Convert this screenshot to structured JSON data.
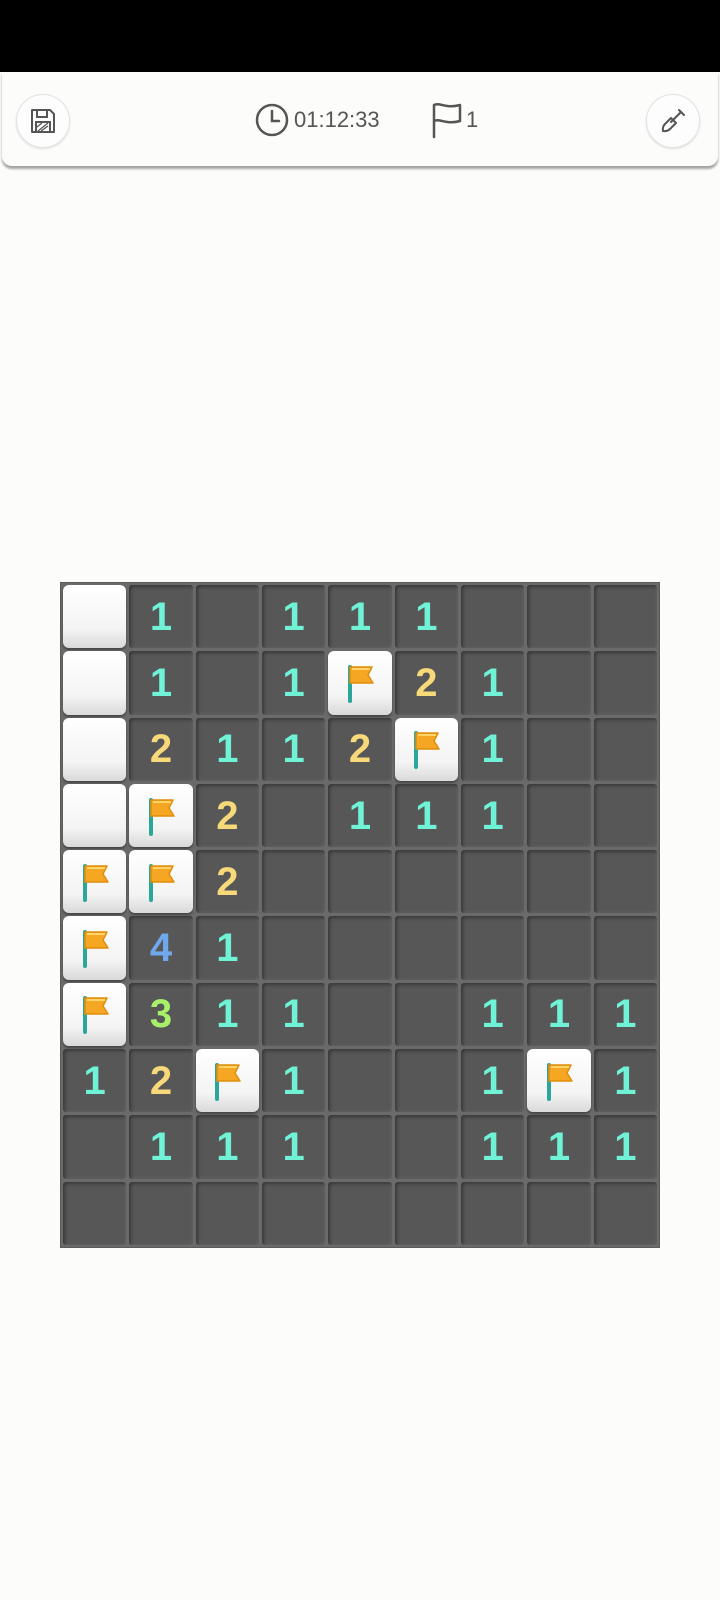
{
  "toolbar": {
    "timer": "01:12:33",
    "flag_count": "1",
    "save_icon": "floppy-disk-icon",
    "timer_icon": "clock-icon",
    "flag_icon": "flag-outline-icon",
    "shovel_icon": "shovel-icon"
  },
  "board": {
    "columns": 9,
    "rows": [
      [
        "C",
        "1",
        "",
        "1",
        "1",
        "1",
        "",
        "",
        ""
      ],
      [
        "C",
        "1",
        "",
        "1",
        "F",
        "2",
        "1",
        "",
        ""
      ],
      [
        "C",
        "2",
        "1",
        "1",
        "2",
        "F",
        "1",
        "",
        ""
      ],
      [
        "C",
        "F",
        "2",
        "",
        "1",
        "1",
        "1",
        "",
        ""
      ],
      [
        "F",
        "F",
        "2",
        "",
        "",
        "",
        "",
        "",
        ""
      ],
      [
        "F",
        "4",
        "1",
        "",
        "",
        "",
        "",
        "",
        ""
      ],
      [
        "F",
        "3",
        "1",
        "1",
        "",
        "",
        "1",
        "1",
        "1"
      ],
      [
        "1",
        "2",
        "F",
        "1",
        "",
        "",
        "1",
        "F",
        "1"
      ],
      [
        "",
        "1",
        "1",
        "1",
        "",
        "",
        "1",
        "1",
        "1"
      ],
      [
        "",
        "",
        "",
        "",
        "",
        "",
        "",
        "",
        ""
      ]
    ],
    "legend": {
      "C": "covered",
      "F": "flagged"
    },
    "colors": {
      "1": "#6ff2d6",
      "2": "#f7d97a",
      "3": "#a8f06a",
      "4": "#6fa8ec",
      "flag": "#f5a623",
      "revealed": "#575757",
      "covered": "#ffffff"
    }
  }
}
